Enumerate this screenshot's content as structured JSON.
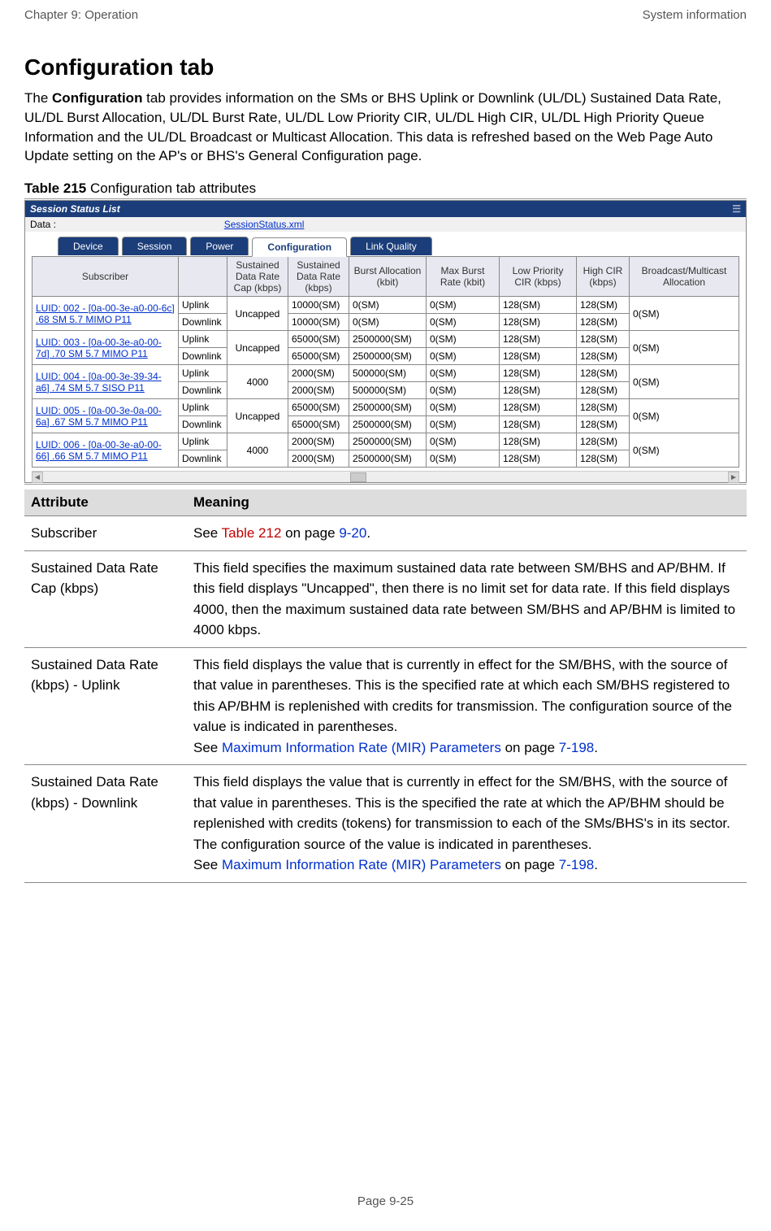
{
  "header": {
    "left": "Chapter 9:  Operation",
    "right": "System information"
  },
  "title": "Configuration tab",
  "intro_before_bold": "The ",
  "intro_bold": "Configuration",
  "intro_after_bold": " tab provides information on the SMs or BHS Uplink or Downlink (UL/DL) Sustained Data Rate, UL/DL Burst Allocation, UL/DL Burst Rate, UL/DL Low Priority CIR, UL/DL High CIR, UL/DL High Priority Queue Information and the UL/DL Broadcast or Multicast Allocation. This data is refreshed based on the Web Page Auto Update setting on the AP's or BHS's General Configuration page.",
  "table_caption_bold": "Table 215",
  "table_caption_rest": " Configuration tab attributes",
  "panel": {
    "title": "Session Status List",
    "data_label": "Data :",
    "data_link": "SessionStatus.xml",
    "tabs": [
      "Device",
      "Session",
      "Power",
      "Configuration",
      "Link Quality"
    ],
    "active_tab": 3,
    "columns": [
      "Subscriber",
      "",
      "Sustained Data Rate Cap (kbps)",
      "Sustained Data Rate (kbps)",
      "Burst Allocation (kbit)",
      "Max Burst Rate (kbit)",
      "Low Priority CIR (kbps)",
      "High CIR (kbps)",
      "Broadcast/Multicast Allocation"
    ],
    "rows": [
      {
        "sub": "LUID: 002 - [0a-00-3e-a0-00-6c] .68 SM 5.7 MIMO P11",
        "cap": "Uncapped",
        "u": {
          "sdr": "10000(SM)",
          "ba": "0(SM)",
          "mbr": "0(SM)",
          "lp": "128(SM)",
          "hc": "128(SM)"
        },
        "d": {
          "sdr": "10000(SM)",
          "ba": "0(SM)",
          "mbr": "0(SM)",
          "lp": "128(SM)",
          "hc": "128(SM)"
        },
        "bm": "0(SM)"
      },
      {
        "sub": "LUID: 003 - [0a-00-3e-a0-00-7d] .70 SM 5.7 MIMO P11",
        "cap": "Uncapped",
        "u": {
          "sdr": "65000(SM)",
          "ba": "2500000(SM)",
          "mbr": "0(SM)",
          "lp": "128(SM)",
          "hc": "128(SM)"
        },
        "d": {
          "sdr": "65000(SM)",
          "ba": "2500000(SM)",
          "mbr": "0(SM)",
          "lp": "128(SM)",
          "hc": "128(SM)"
        },
        "bm": "0(SM)"
      },
      {
        "sub": "LUID: 004 - [0a-00-3e-39-34-a6] .74 SM 5.7 SISO P11",
        "cap": "4000",
        "u": {
          "sdr": "2000(SM)",
          "ba": "500000(SM)",
          "mbr": "0(SM)",
          "lp": "128(SM)",
          "hc": "128(SM)"
        },
        "d": {
          "sdr": "2000(SM)",
          "ba": "500000(SM)",
          "mbr": "0(SM)",
          "lp": "128(SM)",
          "hc": "128(SM)"
        },
        "bm": "0(SM)"
      },
      {
        "sub": "LUID: 005 - [0a-00-3e-0a-00-6a] .67 SM 5.7 MIMO P11",
        "cap": "Uncapped",
        "u": {
          "sdr": "65000(SM)",
          "ba": "2500000(SM)",
          "mbr": "0(SM)",
          "lp": "128(SM)",
          "hc": "128(SM)"
        },
        "d": {
          "sdr": "65000(SM)",
          "ba": "2500000(SM)",
          "mbr": "0(SM)",
          "lp": "128(SM)",
          "hc": "128(SM)"
        },
        "bm": "0(SM)"
      },
      {
        "sub": "LUID: 006 - [0a-00-3e-a0-00-66] .66 SM 5.7 MIMO P11",
        "cap": "4000",
        "u": {
          "sdr": "2000(SM)",
          "ba": "2500000(SM)",
          "mbr": "0(SM)",
          "lp": "128(SM)",
          "hc": "128(SM)"
        },
        "d": {
          "sdr": "2000(SM)",
          "ba": "2500000(SM)",
          "mbr": "0(SM)",
          "lp": "128(SM)",
          "hc": "128(SM)"
        },
        "bm": "0(SM)"
      }
    ],
    "dir_labels": {
      "u": "Uplink",
      "d": "Downlink"
    }
  },
  "attr_table": {
    "headers": [
      "Attribute",
      "Meaning"
    ],
    "rows": [
      {
        "attr": "Subscriber",
        "meaning_parts": [
          "See ",
          {
            "link_red": "Table 212"
          },
          " on page ",
          {
            "link": "9-20"
          },
          "."
        ]
      },
      {
        "attr": "Sustained Data Rate Cap (kbps)",
        "meaning_parts": [
          "This field specifies the maximum sustained data rate between SM/BHS and AP/BHM. If this field displays \"Uncapped\", then there is no limit set for data rate. If this field displays 4000, then the maximum sustained data rate between SM/BHS and AP/BHM is limited to 4000 kbps."
        ]
      },
      {
        "attr": "Sustained Data Rate (kbps) - Uplink",
        "meaning_parts": [
          "This field displays the value that is currently in effect for the SM/BHS, with the source of that value in parentheses. This is the specified rate at which each SM/BHS registered to this AP/BHM is replenished with credits for transmission. The configuration source of the value is indicated in parentheses.",
          {
            "br": true
          },
          "See ",
          {
            "link": "Maximum Information Rate (MIR) Parameters"
          },
          " on page ",
          {
            "link": "7-198"
          },
          "."
        ]
      },
      {
        "attr": "Sustained Data Rate (kbps) - Downlink",
        "meaning_parts": [
          "This field displays the value that is currently in effect for the SM/BHS, with the source of that value in parentheses. This is the specified the rate at which the AP/BHM should be replenished with credits (tokens) for transmission to each of the SMs/BHS's in its sector. The configuration source of the value is indicated in parentheses.",
          {
            "br": true
          },
          "See ",
          {
            "link": "Maximum Information Rate (MIR) Parameters"
          },
          " on page ",
          {
            "link": "7-198"
          },
          "."
        ]
      }
    ]
  },
  "page_num": "Page 9-25"
}
